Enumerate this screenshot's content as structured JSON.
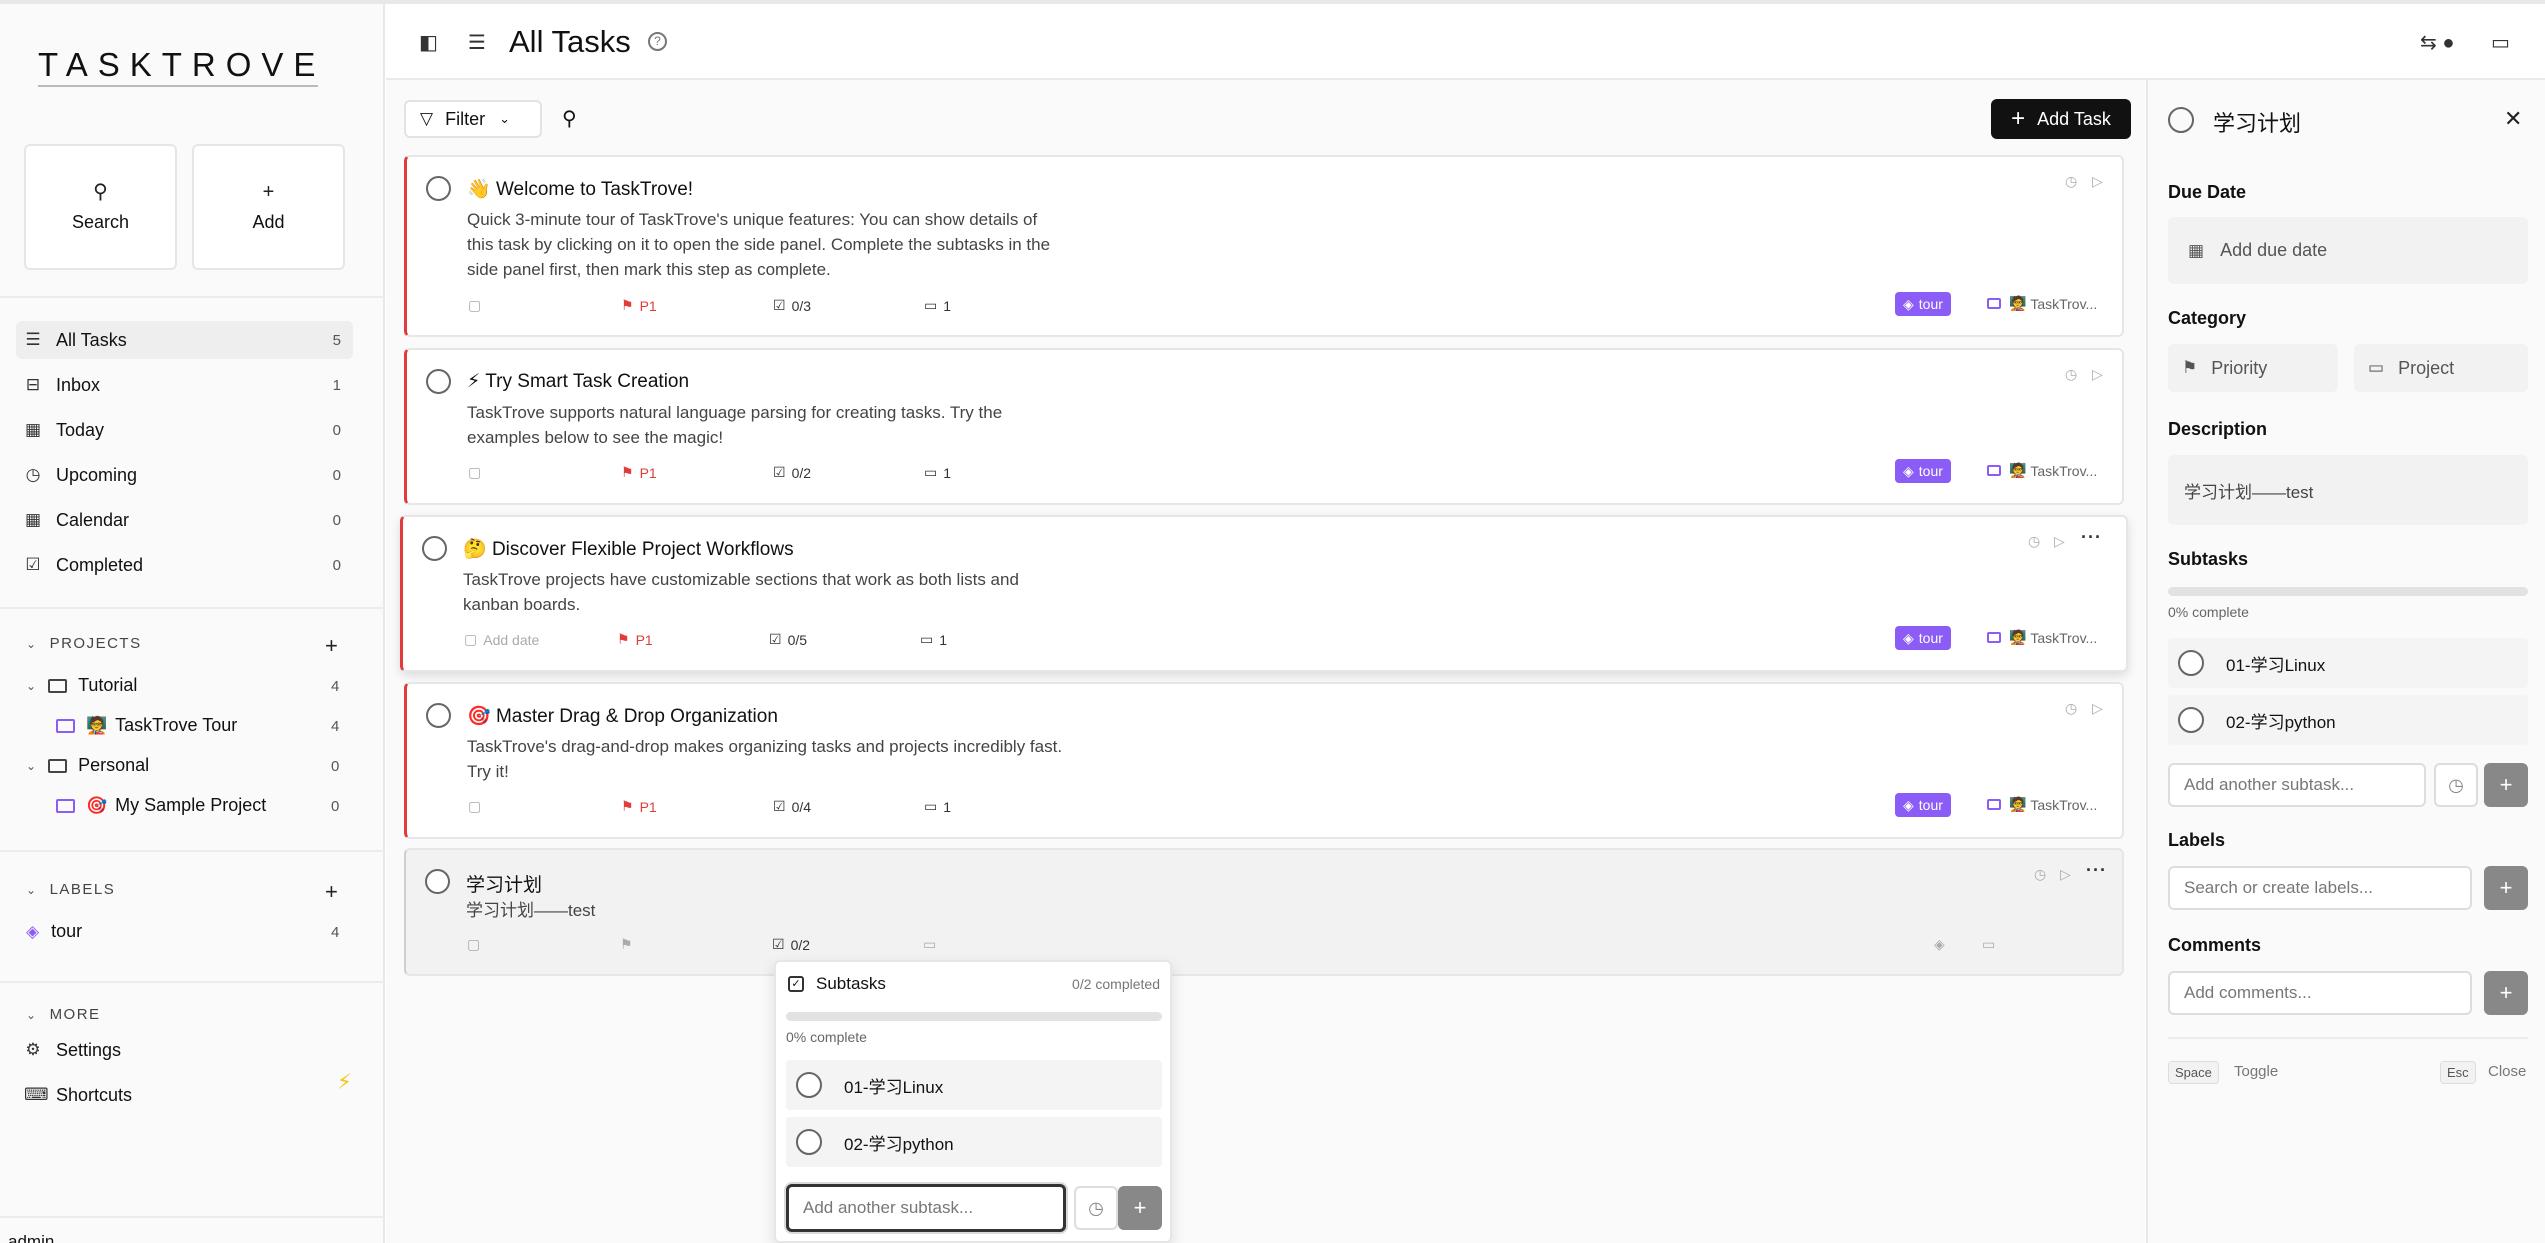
{
  "app": {
    "logo": "TASKTROVE"
  },
  "sidebar": {
    "quick": {
      "search": "Search",
      "add": "Add"
    },
    "nav": [
      {
        "label": "All Tasks",
        "count": "5"
      },
      {
        "label": "Inbox",
        "count": "1"
      },
      {
        "label": "Today",
        "count": "0"
      },
      {
        "label": "Upcoming",
        "count": "0"
      },
      {
        "label": "Calendar",
        "count": "0"
      },
      {
        "label": "Completed",
        "count": "0"
      }
    ],
    "projects_title": "PROJECTS",
    "groups": [
      {
        "label": "Tutorial",
        "count": "4"
      },
      {
        "label": "Personal",
        "count": "0"
      }
    ],
    "projects": [
      {
        "emoji": "🧑‍🏫",
        "label": "TaskTrove Tour",
        "count": "4"
      },
      {
        "emoji": "🎯",
        "label": "My Sample Project",
        "count": "0"
      }
    ],
    "labels_title": "LABELS",
    "labels": [
      {
        "label": "tour",
        "count": "4"
      }
    ],
    "more_title": "MORE",
    "more": [
      {
        "label": "Settings"
      },
      {
        "label": "Shortcuts"
      }
    ],
    "user": "admin"
  },
  "header": {
    "title": "All Tasks"
  },
  "toolbar": {
    "filter": "Filter",
    "add_task": "Add Task"
  },
  "tasks": [
    {
      "emoji": "👋",
      "title": "Welcome to TaskTrove!",
      "desc1": "Quick 3-minute tour of TaskTrove's unique features: You can show details of",
      "desc2": "this task by clicking on it to open the side panel. Complete the subtasks in the",
      "desc3": "side panel first, then mark this step as complete.",
      "priority": "P1",
      "subtasks": "0/3",
      "comments": "1",
      "tag": "tour",
      "project": "TaskTrov..."
    },
    {
      "emoji": "⚡",
      "title": "Try Smart Task Creation",
      "desc1": "TaskTrove supports natural language parsing for creating tasks. Try the",
      "desc2": "examples below to see the magic!",
      "priority": "P1",
      "subtasks": "0/2",
      "comments": "1",
      "tag": "tour",
      "project": "TaskTrov..."
    },
    {
      "emoji": "🤔",
      "title": "Discover Flexible Project Workflows",
      "desc1": "TaskTrove projects have customizable sections that work as both lists and",
      "desc2": "kanban boards.",
      "date": "Add date",
      "priority": "P1",
      "subtasks": "0/5",
      "comments": "1",
      "tag": "tour",
      "project": "TaskTrov..."
    },
    {
      "emoji": "🎯",
      "title": "Master Drag & Drop Organization",
      "desc1": "TaskTrove's drag-and-drop makes organizing tasks and projects incredibly fast.",
      "desc2": "Try it!",
      "priority": "P1",
      "subtasks": "0/4",
      "comments": "1",
      "tag": "tour",
      "project": "TaskTrov..."
    },
    {
      "title": "学习计划",
      "desc1": "学习计划——test",
      "subtasks": "0/2"
    }
  ],
  "popover": {
    "title": "Subtasks",
    "count": "0/2 completed",
    "percent": "0% complete",
    "progress": 0,
    "items": [
      "01-学习Linux",
      "02-学习python"
    ],
    "placeholder": "Add another subtask..."
  },
  "panel": {
    "title": "学习计划",
    "due_label": "Due Date",
    "due_placeholder": "Add due date",
    "category_label": "Category",
    "priority": "Priority",
    "project": "Project",
    "description_label": "Description",
    "description": "学习计划——test",
    "subtasks_label": "Subtasks",
    "percent": "0% complete",
    "progress": 0,
    "subtasks": [
      "01-学习Linux",
      "02-学习python"
    ],
    "subtask_placeholder": "Add another subtask...",
    "labels_label": "Labels",
    "labels_placeholder": "Search or create labels...",
    "comments_label": "Comments",
    "comments_placeholder": "Add comments...",
    "kbd_space": "Space",
    "kbd_space_label": "Toggle",
    "kbd_esc": "Esc",
    "kbd_esc_label": "Close"
  }
}
